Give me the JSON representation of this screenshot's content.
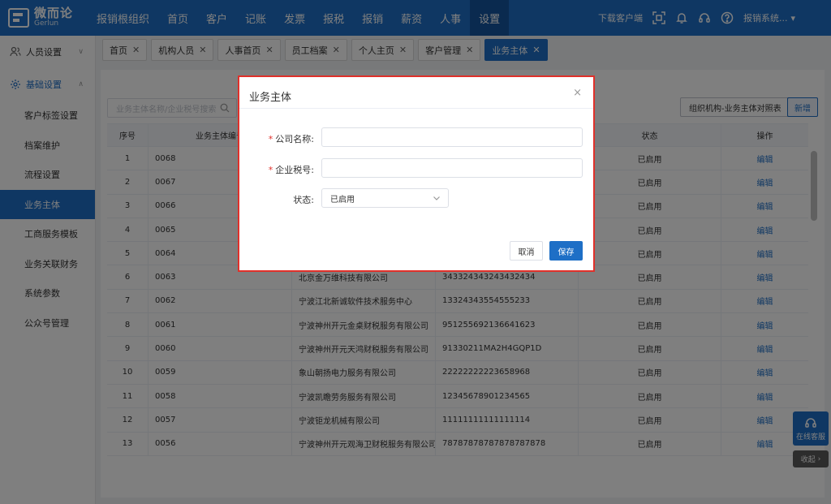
{
  "brand": {
    "name_cn": "微而论",
    "name_en": "Gerlun"
  },
  "nav": [
    {
      "label": "报销根组织",
      "active": false
    },
    {
      "label": "首页",
      "active": false
    },
    {
      "label": "客户",
      "active": false
    },
    {
      "label": "记账",
      "active": false
    },
    {
      "label": "发票",
      "active": false
    },
    {
      "label": "报税",
      "active": false
    },
    {
      "label": "报销",
      "active": false
    },
    {
      "label": "薪资",
      "active": false
    },
    {
      "label": "人事",
      "active": false
    },
    {
      "label": "设置",
      "active": true
    }
  ],
  "topbar": {
    "download_label": "下载客户端",
    "user_label": "报销系统...",
    "icons": [
      "scan-icon",
      "bell-icon",
      "headset-icon",
      "help-icon"
    ]
  },
  "sidebar": {
    "group_person": "人员设置",
    "group_basic": "基础设置",
    "items": [
      {
        "label": "客户标签设置",
        "active": false
      },
      {
        "label": "档案维护",
        "active": false
      },
      {
        "label": "流程设置",
        "active": false
      },
      {
        "label": "业务主体",
        "active": true
      },
      {
        "label": "工商服务模板",
        "active": false
      },
      {
        "label": "业务关联财务",
        "active": false
      },
      {
        "label": "系统参数",
        "active": false
      },
      {
        "label": "公众号管理",
        "active": false
      }
    ]
  },
  "tabs": [
    {
      "label": "首页",
      "active": false
    },
    {
      "label": "机构人员",
      "active": false
    },
    {
      "label": "人事首页",
      "active": false
    },
    {
      "label": "员工档案",
      "active": false
    },
    {
      "label": "个人主页",
      "active": false
    },
    {
      "label": "客户管理",
      "active": false
    },
    {
      "label": "业务主体",
      "active": true
    }
  ],
  "toolbar": {
    "search_placeholder": "业务主体名称/企业税号搜索",
    "org_button": "组织机构-业务主体对照表",
    "new_button": "新增"
  },
  "table": {
    "headers": [
      "序号",
      "业务主体编号",
      "",
      "",
      "状态",
      "操作"
    ],
    "rows": [
      [
        "1",
        "0068",
        "",
        "",
        "已启用",
        "编辑"
      ],
      [
        "2",
        "0067",
        "",
        "",
        "已启用",
        "编辑"
      ],
      [
        "3",
        "0066",
        "",
        "",
        "已启用",
        "编辑"
      ],
      [
        "4",
        "0065",
        "",
        "",
        "已启用",
        "编辑"
      ],
      [
        "5",
        "0064",
        "",
        "",
        "已启用",
        "编辑"
      ],
      [
        "6",
        "0063",
        "北京金万维科技有限公司",
        "343324343243432434",
        "已启用",
        "编辑"
      ],
      [
        "7",
        "0062",
        "宁波江北新诚软件技术服务中心",
        "13324343554555233",
        "已启用",
        "编辑"
      ],
      [
        "8",
        "0061",
        "宁波神州开元金桌财税服务有限公司",
        "951255692136641623",
        "已启用",
        "编辑"
      ],
      [
        "9",
        "0060",
        "宁波神州开元天鸿财税服务有限公司",
        "91330211MA2H4GQP1D",
        "已启用",
        "编辑"
      ],
      [
        "10",
        "0059",
        "象山朝扬电力服务有限公司",
        "22222222223658968",
        "已启用",
        "编辑"
      ],
      [
        "11",
        "0058",
        "宁波凯瞻劳务服务有限公司",
        "12345678901234565",
        "已启用",
        "编辑"
      ],
      [
        "12",
        "0057",
        "宁波钜龙机械有限公司",
        "11111111111111114",
        "已启用",
        "编辑"
      ],
      [
        "13",
        "0056",
        "宁波神州开元观海卫财税服务有限公司",
        "78787878787878787878",
        "已启用",
        "编辑"
      ]
    ]
  },
  "dialog": {
    "title": "业务主体",
    "close": "×",
    "company_label": "公司名称:",
    "company_value": "",
    "tax_label": "企业税号:",
    "tax_value": "",
    "status_label": "状态:",
    "status_value": "已启用",
    "cancel": "取消",
    "save": "保存"
  },
  "service": {
    "label": "在线客服",
    "collapse": "收起"
  },
  "colors": {
    "primary": "#1e6fc6",
    "highlight_border": "#e0302a"
  }
}
